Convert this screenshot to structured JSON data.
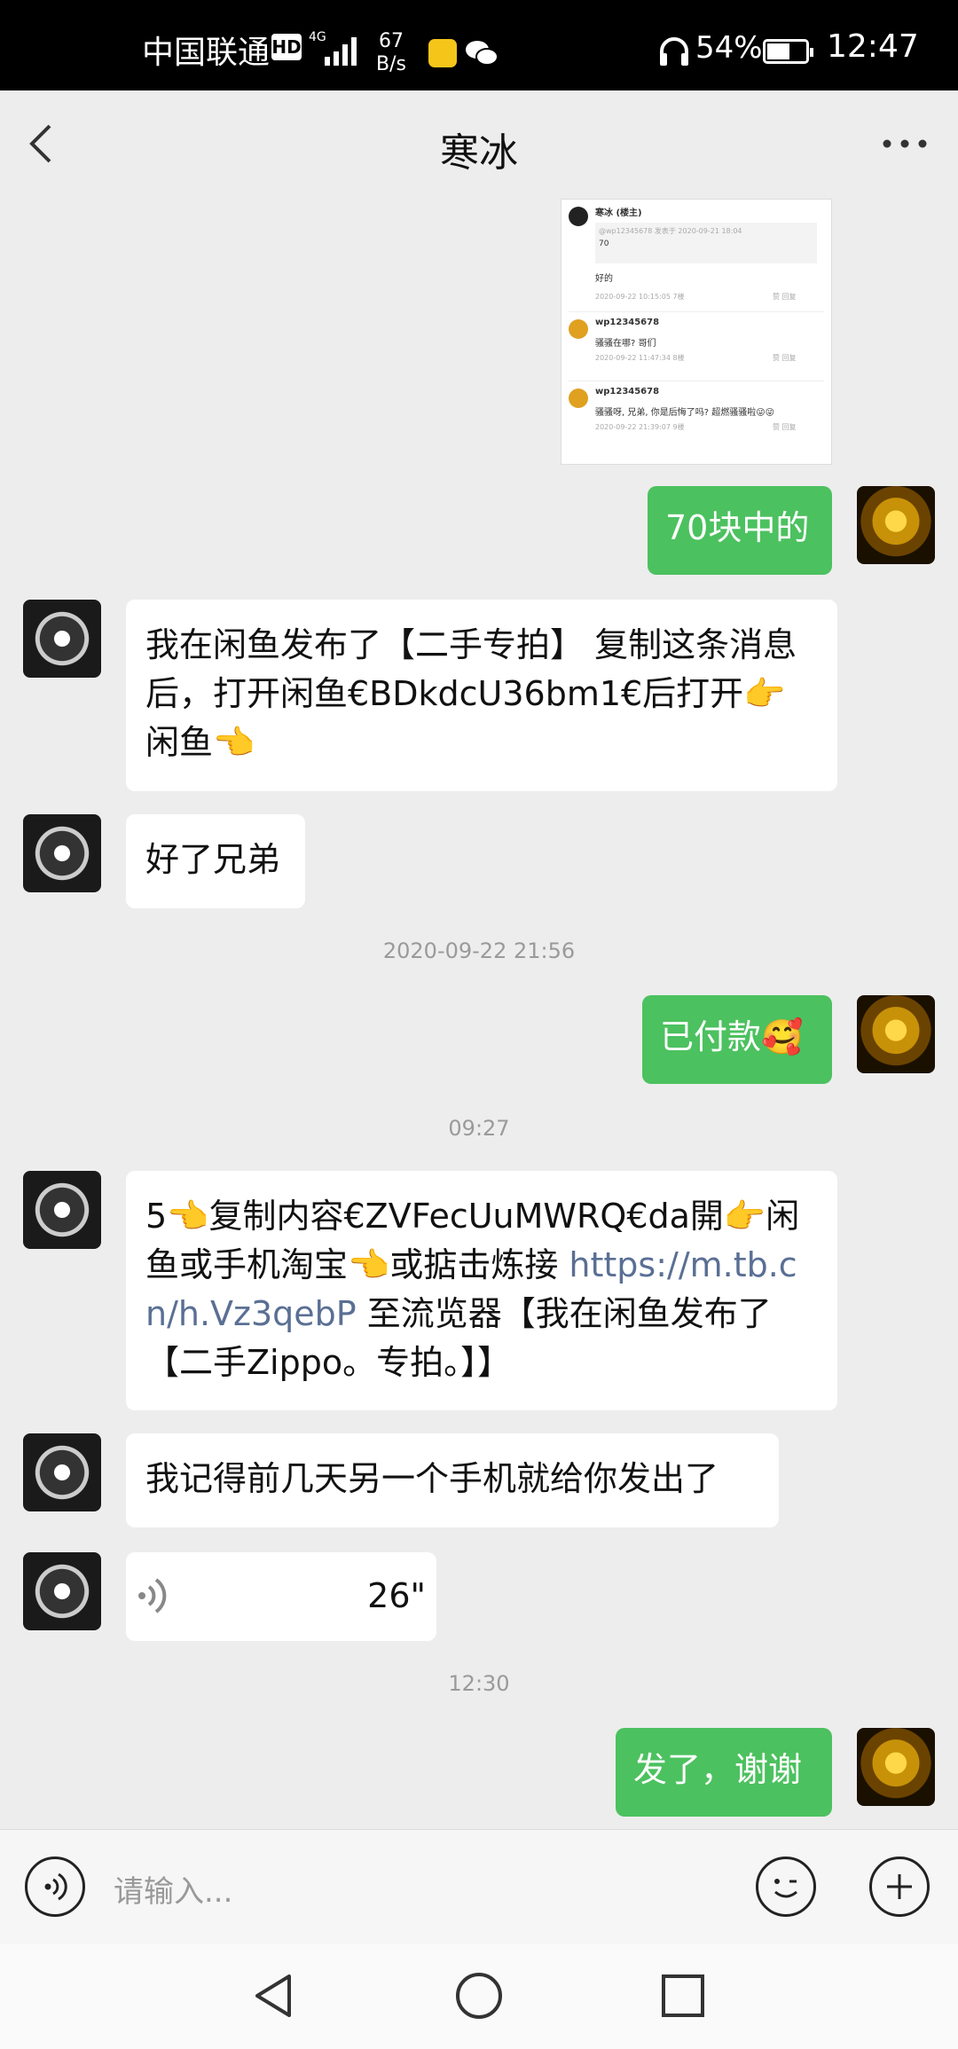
{
  "status_bar": {
    "carrier": "中国联通",
    "hd_label": "HD",
    "network": "4G",
    "speed_value": "67",
    "speed_unit": "B/s",
    "battery": "54%",
    "time": "12:47"
  },
  "header": {
    "title": "寒冰",
    "back_icon": "chevron-left-icon",
    "more_icon": "more-horizontal-icon"
  },
  "screenshot_preview": {
    "items": [
      {
        "user": "寒冰 (楼主)",
        "quote": "@wp12345678 发表于 2020-09-21 18:04",
        "quote_text": "70",
        "text": "好的",
        "meta": "2020-09-22 10:15:05 7楼"
      },
      {
        "user": "wp12345678",
        "text": "骚骚在哪? 哥们",
        "meta": "2020-09-22 11:47:34 8楼"
      },
      {
        "user": "wp12345678",
        "text": "骚骚呀, 兄弟, 你是后悔了吗? 超燃骚骚啦😜😜",
        "meta": "2020-09-22 21:39:07 9楼"
      }
    ],
    "like_label": "赞",
    "reply_label": "回复"
  },
  "messages": [
    {
      "text": "70块中的"
    },
    {
      "text": "我在闲鱼发布了【二手专拍】 复制这条消息后，打开闲鱼€BDkdcU36bm1€后打开👉闲鱼👈"
    },
    {
      "text": "好了兄弟"
    },
    {
      "text": "2020-09-22 21:56"
    },
    {
      "text": "已付款🥰"
    },
    {
      "text": "09:27"
    },
    {
      "text_a": "5👈复制内容€ZVFecUuMWRQ€da開👉闲鱼或手机淘宝👈或掂击炼接 ",
      "link": "https://m.tb.cn/h.Vz3qebP",
      "text_b": " 至流览器【我在闲鱼发布了【二手Zippo。专拍。】】"
    },
    {
      "text": "我记得前几天另一个手机就给你发出了"
    },
    {
      "duration": "26\""
    },
    {
      "text": "12:30"
    },
    {
      "text": "发了，谢谢"
    }
  ],
  "input_bar": {
    "placeholder": "请输入...",
    "voice_icon": "voice-icon",
    "emoji_icon": "emoji-icon",
    "plus_icon": "plus-icon"
  },
  "nav_bar": {
    "back_icon": "nav-back-icon",
    "home_icon": "nav-home-icon",
    "recents_icon": "nav-recents-icon"
  },
  "colors": {
    "background": "#ededed",
    "bubble_self": "#4cc15f",
    "bubble_other": "#ffffff",
    "link": "#5a6f94"
  }
}
